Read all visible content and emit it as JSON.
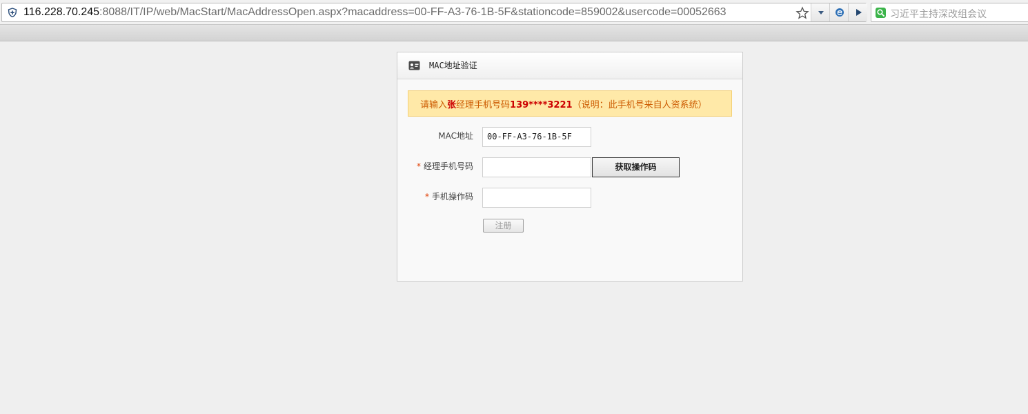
{
  "browser": {
    "url_host": "116.228.70.245",
    "url_rest": ":8088/IT/IP/web/MacStart/MacAddressOpen.aspx?macaddress=00-FF-A3-76-1B-5F&stationcode=859002&usercode=00052663",
    "search_placeholder": "习近平主持深改组会议"
  },
  "panel": {
    "title": "MAC地址验证",
    "notice": {
      "prefix": "请输入",
      "name": "张",
      "middle": "经理手机号码",
      "phone": "139****3221",
      "suffix": "（说明：此手机号来自人资系统）"
    },
    "form": {
      "mac_label": "MAC地址",
      "mac_value": "00-FF-A3-76-1B-5F",
      "required_mark": "*",
      "phone_label": "经理手机号码",
      "phone_value": "",
      "code_label": "手机操作码",
      "code_value": "",
      "getcode_label": "获取操作码",
      "register_label": "注册"
    }
  },
  "icons": {
    "security": "shield-icon",
    "bookmark": "star-icon",
    "dropdown": "chevron-down-icon",
    "compat": "ie-icon",
    "go": "play-icon",
    "search_engine": "search-icon",
    "panel": "id-card-icon"
  }
}
